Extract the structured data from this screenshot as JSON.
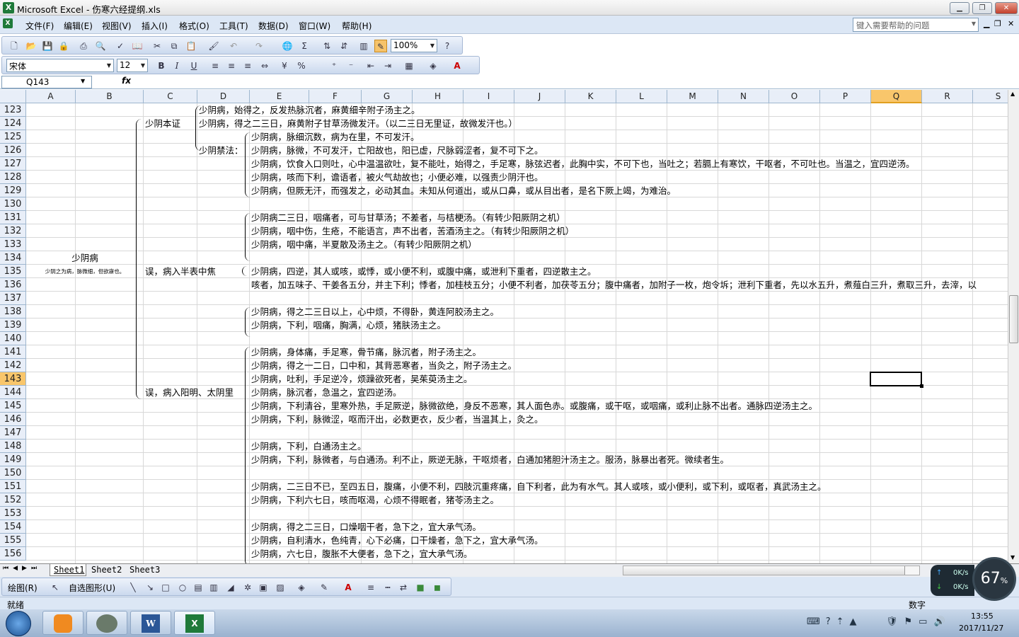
{
  "window": {
    "title": "Microsoft Excel - 伤寒六经提纲.xls",
    "min": "▁",
    "restore": "❐",
    "close": "✕"
  },
  "menu": {
    "items": [
      "文件(F)",
      "编辑(E)",
      "视图(V)",
      "插入(I)",
      "格式(O)",
      "工具(T)",
      "数据(D)",
      "窗口(W)",
      "帮助(H)"
    ],
    "help_placeholder": "键入需要帮助的问题"
  },
  "toolbar": {
    "zoom": "100%",
    "font": "宋体",
    "size": "12",
    "bold": "B",
    "italic": "I",
    "underline": "U",
    "percent": "%"
  },
  "formula_bar": {
    "name_box": "Q143",
    "fx": "fx",
    "value": ""
  },
  "columns": [
    "A",
    "B",
    "C",
    "D",
    "E",
    "F",
    "G",
    "H",
    "I",
    "J",
    "K",
    "L",
    "M",
    "N",
    "O",
    "P",
    "Q",
    "R",
    "S"
  ],
  "selected_col": "Q",
  "selected_row": "143",
  "rows": [
    {
      "n": "123",
      "cells": [
        {
          "col": "D",
          "text": "少阴病，始得之，反发热脉沉者，麻黄细辛附子汤主之。"
        }
      ]
    },
    {
      "n": "124",
      "cells": [
        {
          "col": "C",
          "text": "少阴本证"
        },
        {
          "col": "D",
          "text": "少阴病，得之二三日，麻黄附子甘草汤微发汗。（以二三日无里证，故微发汗也。）"
        }
      ]
    },
    {
      "n": "125",
      "cells": [
        {
          "col": "E",
          "text": "少阴病，脉细沉数，病为在里，不可发汗。"
        }
      ]
    },
    {
      "n": "126",
      "cells": [
        {
          "col": "D",
          "text": "少阴禁法："
        },
        {
          "col": "E",
          "text": "少阴病，脉微，不可发汗，亡阳故也，阳已虚，尺脉弱涩者，复不可下之。"
        }
      ]
    },
    {
      "n": "127",
      "cells": [
        {
          "col": "E",
          "text": "少阴病，饮食入口则吐，心中温温欲吐，复不能吐，始得之，手足寒，脉弦迟者，此胸中实，不可下也，当吐之；若膈上有寒饮，干呕者，不可吐也。当温之，宜四逆汤。"
        }
      ]
    },
    {
      "n": "128",
      "cells": [
        {
          "col": "E",
          "text": "少阴病，咳而下利，谵语者，被火气劫故也；小便必难，以强责少阴汗也。"
        }
      ]
    },
    {
      "n": "129",
      "cells": [
        {
          "col": "E",
          "text": "少阴病，但厥无汗，而强发之，必动其血。未知从何道出，或从口鼻，或从目出者，是名下厥上竭，为难治。"
        }
      ]
    },
    {
      "n": "130",
      "cells": []
    },
    {
      "n": "131",
      "cells": [
        {
          "col": "E",
          "text": "少阴病二三日，咽痛者，可与甘草汤；不差者，与桔梗汤。（有转少阳厥阴之机）"
        }
      ]
    },
    {
      "n": "132",
      "cells": [
        {
          "col": "E",
          "text": "少阴病，咽中伤，生疮，不能语言，声不出者，苦酒汤主之。（有转少阳厥阴之机）"
        }
      ]
    },
    {
      "n": "133",
      "cells": [
        {
          "col": "E",
          "text": "少阴病，咽中痛，半夏散及汤主之。（有转少阳厥阴之机）"
        }
      ]
    },
    {
      "n": "134",
      "cells": [
        {
          "col": "AB",
          "text": "少阴病"
        }
      ]
    },
    {
      "n": "135",
      "cells": [
        {
          "col": "AB",
          "text": "少阴之为病，脉微细，但欲寐也。",
          "small": true
        },
        {
          "col": "C",
          "text": "误，病入半表中焦"
        },
        {
          "col": "E",
          "text": "少阴病，四逆，其人或咳，或悸，或小便不利，或腹中痛，或泄利下重者，四逆散主之。"
        }
      ]
    },
    {
      "n": "136",
      "cells": [
        {
          "col": "E",
          "text": "咳者，加五味子、干姜各五分，并主下利；悸者，加桂枝五分；小便不利者，加茯苓五分；腹中痛者，加附子一枚，炮令坼；泄利下重者，先以水五升，煮薤白三升，煮取三升，去滓，以"
        }
      ]
    },
    {
      "n": "137",
      "cells": []
    },
    {
      "n": "138",
      "cells": [
        {
          "col": "E",
          "text": "少阴病，得之二三日以上，心中烦，不得卧，黄连阿胶汤主之。"
        }
      ]
    },
    {
      "n": "139",
      "cells": [
        {
          "col": "E",
          "text": "少阴病，下利，咽痛，胸满，心烦，猪肤汤主之。"
        }
      ]
    },
    {
      "n": "140",
      "cells": []
    },
    {
      "n": "141",
      "cells": [
        {
          "col": "E",
          "text": "少阴病，身体痛，手足寒，骨节痛，脉沉者，附子汤主之。"
        }
      ]
    },
    {
      "n": "142",
      "cells": [
        {
          "col": "E",
          "text": "少阴病，得之一二日，口中和，其背恶寒者，当灸之，附子汤主之。"
        }
      ]
    },
    {
      "n": "143",
      "cells": [
        {
          "col": "E",
          "text": "少阴病，吐利，手足逆冷，烦躁欲死者，吴茱萸汤主之。"
        }
      ]
    },
    {
      "n": "144",
      "cells": [
        {
          "col": "C",
          "text": "误，病入阳明、太阴里"
        },
        {
          "col": "E",
          "text": "少阴病，脉沉者，急温之，宜四逆汤。"
        }
      ]
    },
    {
      "n": "145",
      "cells": [
        {
          "col": "E",
          "text": "少阴病，下利清谷，里寒外热，手足厥逆，脉微欲绝，身反不恶寒，其人面色赤。或腹痛，或干呕，或咽痛，或利止脉不出者。通脉四逆汤主之。"
        }
      ]
    },
    {
      "n": "146",
      "cells": [
        {
          "col": "E",
          "text": "少阴病，下利，脉微涩，呕而汗出，必数更衣，反少者，当温其上，灸之。"
        }
      ]
    },
    {
      "n": "147",
      "cells": []
    },
    {
      "n": "148",
      "cells": [
        {
          "col": "E",
          "text": "少阴病，下利，白通汤主之。"
        }
      ]
    },
    {
      "n": "149",
      "cells": [
        {
          "col": "E",
          "text": "少阴病，下利，脉微者，与白通汤。利不止，厥逆无脉，干呕烦者，白通加猪胆汁汤主之。服汤，脉暴出者死。微续者生。"
        }
      ]
    },
    {
      "n": "150",
      "cells": []
    },
    {
      "n": "151",
      "cells": [
        {
          "col": "E",
          "text": "少阴病，二三日不已，至四五日，腹痛，小便不利，四肢沉重疼痛，自下利者，此为有水气。其人或咳，或小便利，或下利，或呕者，真武汤主之。"
        }
      ]
    },
    {
      "n": "152",
      "cells": [
        {
          "col": "E",
          "text": "少阴病，下利六七日，咳而呕渴，心烦不得眠者，猪苓汤主之。"
        }
      ]
    },
    {
      "n": "153",
      "cells": []
    },
    {
      "n": "154",
      "cells": [
        {
          "col": "E",
          "text": "少阴病，得之二三日，口燥咽干者，急下之，宜大承气汤。"
        }
      ]
    },
    {
      "n": "155",
      "cells": [
        {
          "col": "E",
          "text": "少阴病，自利清水，色纯青，心下必痛，口干燥者，急下之，宜大承气汤。"
        }
      ]
    },
    {
      "n": "156",
      "cells": [
        {
          "col": "E",
          "text": "少阴病，六七日，腹胀不大便者，急下之，宜大承气汤。"
        }
      ]
    }
  ],
  "sheets": [
    "Sheet1",
    "Sheet2",
    "Sheet3"
  ],
  "drawbar": {
    "draw": "绘图(R)",
    "autoshape": "自选图形(U)"
  },
  "status": {
    "left": "就绪",
    "mode": "数字"
  },
  "network": {
    "up": "0K/s",
    "down": "0K/s",
    "percent": "67",
    "pct_sign": "%"
  },
  "clock": {
    "time": "13:55",
    "date": "2017/11/27"
  }
}
